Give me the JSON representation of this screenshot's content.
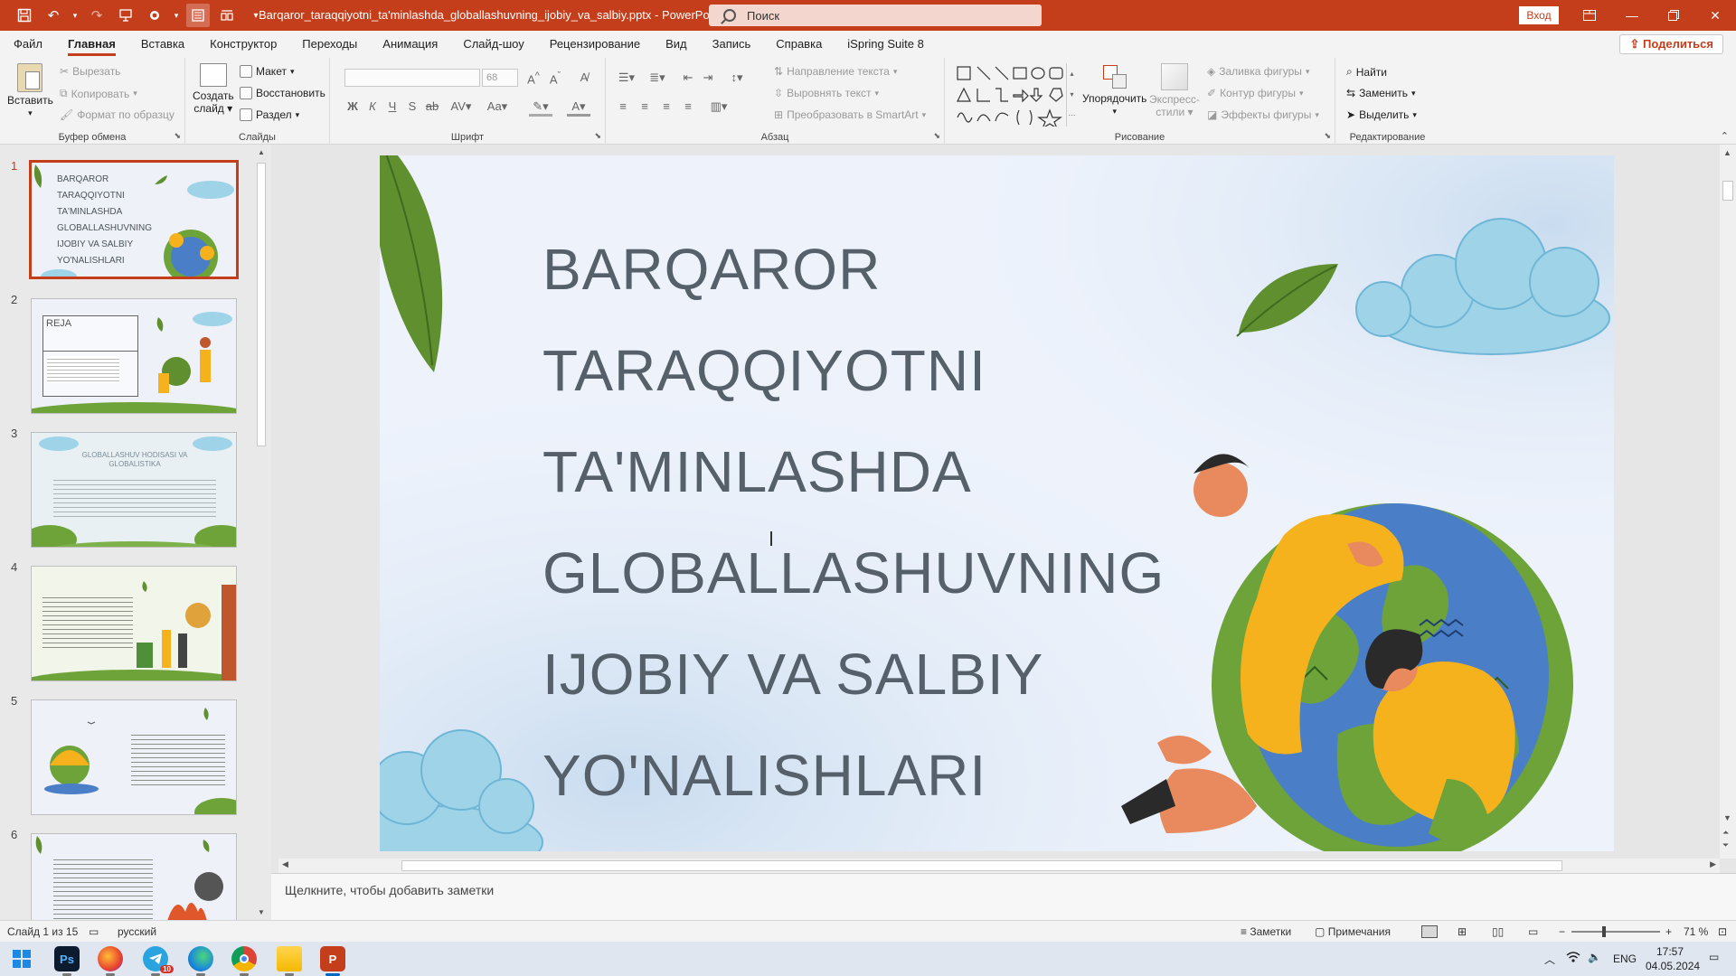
{
  "titlebar": {
    "doc_title": "Barqaror_taraqqiyotni_ta'minlashda_globallashuvning_ijobiy_va_salbiy.pptx  -  PowerPoint",
    "search_placeholder": "Поиск",
    "signin": "Вход"
  },
  "menu": {
    "tabs": [
      "Файл",
      "Главная",
      "Вставка",
      "Конструктор",
      "Переходы",
      "Анимация",
      "Слайд-шоу",
      "Рецензирование",
      "Вид",
      "Запись",
      "Справка",
      "iSpring Suite 8"
    ],
    "active": "Главная",
    "share": "Поделиться"
  },
  "ribbon": {
    "clipboard": {
      "label": "Буфер обмена",
      "paste": "Вставить",
      "cut": "Вырезать",
      "copy": "Копировать",
      "format_painter": "Формат по образцу"
    },
    "slides": {
      "label": "Слайды",
      "new_slide_1": "Создать",
      "new_slide_2": "слайд",
      "layout": "Макет",
      "reset": "Восстановить",
      "section": "Раздел"
    },
    "font": {
      "label": "Шрифт",
      "size": "68"
    },
    "paragraph": {
      "label": "Абзац",
      "text_direction": "Направление текста",
      "align_text": "Выровнять текст",
      "smartart": "Преобразовать в SmartArt"
    },
    "drawing": {
      "label": "Рисование",
      "arrange": "Упорядочить",
      "quick_styles_1": "Экспресс-",
      "quick_styles_2": "стили",
      "fill": "Заливка фигуры",
      "outline": "Контур фигуры",
      "effects": "Эффекты фигуры"
    },
    "editing": {
      "label": "Редактирование",
      "find": "Найти",
      "replace": "Заменить",
      "select": "Выделить"
    }
  },
  "thumbnails": [
    {
      "num": "1",
      "lines": [
        "BARQAROR",
        "TARAQQIYOTNI",
        "TA'MINLASHDA",
        "GLOBALLASHUVNING",
        "IJOBIY VA SALBIY",
        "YO'NALISHLARI"
      ]
    },
    {
      "num": "2",
      "title": "REJA"
    },
    {
      "num": "3",
      "title": "GLOBALLASHUV HODISASI VA GLOBALISTIKA"
    },
    {
      "num": "4"
    },
    {
      "num": "5"
    },
    {
      "num": "6"
    }
  ],
  "slide": {
    "title_lines": [
      "BARQAROR",
      "TARAQQIYOTNI",
      "TA'MINLASHDA",
      "GLOBALLASHUVNING",
      "IJOBIY VA SALBIY",
      "YO'NALISHLARI"
    ]
  },
  "notes_placeholder": "Щелкните, чтобы добавить заметки",
  "status": {
    "slide_counter": "Слайд 1 из 15",
    "language": "русский",
    "notes": "Заметки",
    "comments": "Примечания",
    "zoom": "71 %"
  },
  "tray": {
    "lang": "ENG",
    "time": "17:57",
    "date": "04.05.2024",
    "telegram_badge": "10"
  },
  "colors": {
    "accent": "#c43e1c",
    "title_text": "#55606a",
    "leaf_green": "#6ea33a",
    "cloud_blue": "#9fd3e8",
    "globe_blue": "#4a7fc8",
    "person_yellow": "#f5b21c"
  }
}
